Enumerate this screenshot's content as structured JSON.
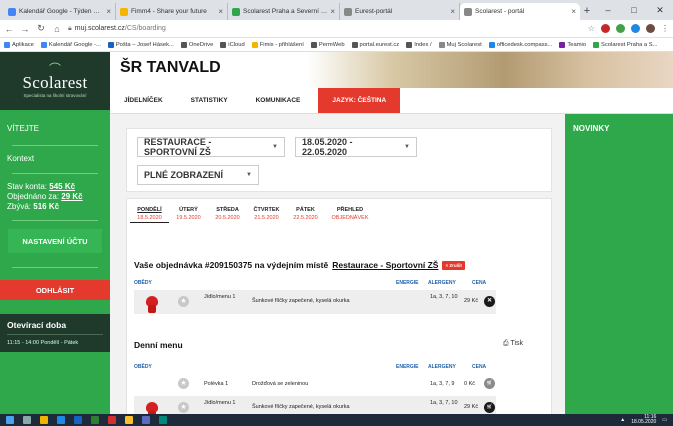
{
  "browser": {
    "tabs": [
      {
        "title": "Kalendář Google - Týden od 11. k",
        "color": "#4285f4",
        "active": false
      },
      {
        "title": "Fimm4 - Share your future",
        "color": "#f4b400",
        "active": false
      },
      {
        "title": "Scolarest Praha a Severní Čechy",
        "color": "#2ea84a",
        "active": false
      },
      {
        "title": "Eurest-portál",
        "color": "#888888",
        "active": false
      },
      {
        "title": "Scolarest - portál",
        "color": "#888888",
        "active": true
      }
    ],
    "new_tab": "+",
    "close_glyph": "×",
    "window_controls": [
      "–",
      "□",
      "✕"
    ],
    "url_prefix": "muj.scolarest.cz",
    "url_path": "/CS/boarding",
    "bookmarks": [
      {
        "label": "Aplikace",
        "color": "#4285f4"
      },
      {
        "label": "Kalendář Google -...",
        "color": "#4285f4"
      },
      {
        "label": "Pošta – Josef Hásek...",
        "color": "#1565c0"
      },
      {
        "label": "OneDrive",
        "color": "#555555"
      },
      {
        "label": "iCloud",
        "color": "#555555"
      },
      {
        "label": "Fimis - přihlášení",
        "color": "#f4b400"
      },
      {
        "label": "PermWeb",
        "color": "#555555"
      },
      {
        "label": "portal.eurest.cz",
        "color": "#555555"
      },
      {
        "label": "Index /",
        "color": "#555555"
      },
      {
        "label": "Muj Scolarest",
        "color": "#888888"
      },
      {
        "label": "officedesk.compass...",
        "color": "#1e88e5"
      },
      {
        "label": "Teamio",
        "color": "#7b1fa2"
      },
      {
        "label": "Scolarest Praha a S...",
        "color": "#2ea84a"
      }
    ]
  },
  "sidebar": {
    "logo_name": "Scolarest",
    "logo_tag": "Specialista na školní stravování",
    "welcome": "VÍTEJTE",
    "context": "Kontext",
    "balance_label": "Stav konta:",
    "balance_value": "545 Kč",
    "ordered_label": "Objednáno za:",
    "ordered_value": "29 Kč",
    "remaining_label": "Zbývá:",
    "remaining_value": "516 Kč",
    "settings_button": "NASTAVENÍ ÚČTU",
    "logout_button": "ODHLÁSIT",
    "hours_title": "Otevírací doba",
    "hours_value": "11:15 - 14:00 Pondělí - Pátek"
  },
  "header": {
    "school": "ŠR TANVALD"
  },
  "nav": {
    "items": [
      "JÍDELNÍČEK",
      "STATISTIKY",
      "KOMUNIKACE"
    ],
    "language": "JAZYK: ČEŠTINA"
  },
  "filters": {
    "restaurant": "RESTAURACE - SPORTOVNÍ ZŠ",
    "week": "18.05.2020 - 22.05.2020",
    "view": "PLNÉ ZOBRAZENÍ"
  },
  "days": [
    {
      "name": "PONDĚLÍ",
      "date": "18.5.2020",
      "active": true
    },
    {
      "name": "ÚTERÝ",
      "date": "19.5.2020",
      "active": false
    },
    {
      "name": "STŘEDA",
      "date": "20.5.2020",
      "active": false
    },
    {
      "name": "ČTVRTEK",
      "date": "21.5.2020",
      "active": false
    },
    {
      "name": "PÁTEK",
      "date": "22.5.2020",
      "active": false
    },
    {
      "name": "PŘEHLED",
      "date": "OBJEDNÁVEK",
      "active": false
    }
  ],
  "order": {
    "title_prefix": "Vaše objednávka #209150375 na výdejním místě",
    "place": "Restaurace - Sportovní ZŠ",
    "cancel": "× Zrušit",
    "section": "OBĚDY",
    "col_energy": "ENERGIE",
    "col_allergens": "ALERGENY",
    "col_price": "CENA",
    "row": {
      "type": "Jídlo/menu 1",
      "meal": "Šunkové flíčky zapečené, kyselá okurka",
      "allergens": "1a, 3, 7, 10",
      "price": "29 Kč"
    }
  },
  "daily_menu": {
    "title": "Denní menu",
    "print": "Tisk",
    "section": "OBĚDY",
    "col_energy": "ENERGIE",
    "col_allergens": "ALERGENY",
    "col_price": "CENA",
    "rows": [
      {
        "type": "Polévka 1",
        "meal": "Drožďová se zeleninou",
        "allergens": "1a, 3, 7, 9",
        "price": "0 Kč"
      },
      {
        "type": "Jídlo/menu 1",
        "meal": "Šunkové flíčky zapečené, kyselá okurka",
        "allergens": "1a, 3, 7, 10",
        "price": "29 Kč"
      }
    ]
  },
  "news": {
    "title": "NOVINKY"
  },
  "taskbar": {
    "time": "11:16",
    "date": "18.05.2020"
  }
}
